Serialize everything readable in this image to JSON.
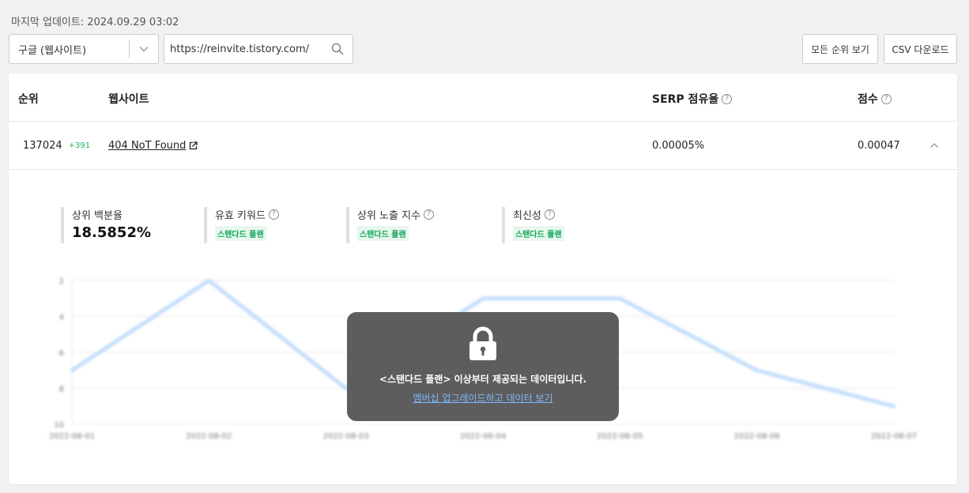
{
  "header": {
    "last_updated": "마지막 업데이트: 2024.09.29 03:02"
  },
  "filters": {
    "engine_select": "구글 (웹사이트)",
    "search_value": "https://reinvite.tistory.com/",
    "view_all_label": "모든 순위 보기",
    "csv_label": "CSV 다운로드"
  },
  "table": {
    "columns": {
      "rank": "순위",
      "website": "웹사이트",
      "serp": "SERP 점유율",
      "score": "점수"
    },
    "row": {
      "rank": "137024",
      "rank_change": "+391",
      "website": "404 NoT Found",
      "serp": "0.00005%",
      "score": "0.00047"
    }
  },
  "metrics": [
    {
      "label": "상위 백분율",
      "value": "18.5852%"
    },
    {
      "label": "유효 키워드",
      "badge": "스탠다드 플랜"
    },
    {
      "label": "상위 노출 지수",
      "badge": "스탠다드 플랜"
    },
    {
      "label": "최신성",
      "badge": "스탠다드 플랜"
    }
  ],
  "chart_data": {
    "type": "line",
    "x": [
      "2022-08-01",
      "2022-08-02",
      "2022-08-03",
      "2022-08-04",
      "2022-08-05",
      "2022-08-06",
      "2022-08-07"
    ],
    "yticks": [
      "2",
      "4",
      "6",
      "8",
      "10"
    ],
    "ylim": [
      2,
      10
    ],
    "y_inverted": true,
    "series": [
      {
        "values": [
          7,
          2,
          8,
          3,
          3,
          7,
          9
        ]
      }
    ],
    "color": "#c3ddfb",
    "grid": true
  },
  "overlay": {
    "message": "<스탠다드 플랜> 이상부터 제공되는 데이터입니다.",
    "link": "멤버십 업그레이드하고 데이터 보기"
  },
  "colors": {
    "accent_green": "#1bb35a",
    "badge_bg": "#e7f7ef",
    "overlay_bg": "#5d5d5d",
    "link_blue": "#7fb8ff"
  }
}
